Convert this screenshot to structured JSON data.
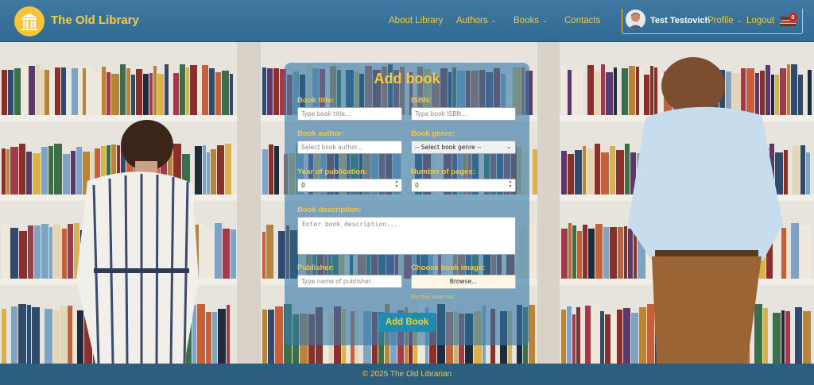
{
  "header": {
    "logo_icon": "library-columns-icon",
    "brand": "The Old Library",
    "nav": {
      "about": "About Library",
      "authors": "Authors",
      "books": "Books",
      "contacts": "Contacts"
    },
    "user": {
      "name": "Test Testovich",
      "profile": "Profile",
      "logout": "Logout",
      "cart_icon": "books-stack-icon",
      "cart_count": "0"
    }
  },
  "form": {
    "title": "Add book",
    "book_title": {
      "label": "Book title:",
      "placeholder": "Type book title..."
    },
    "isbn": {
      "label": "ISBN:",
      "placeholder": "Type book ISBN..."
    },
    "book_author": {
      "label": "Book author:",
      "placeholder": "Select book author..."
    },
    "book_genre": {
      "label": "Book genre:",
      "value": "-- Select book genre --"
    },
    "year": {
      "label": "Year of publication:",
      "value": "0"
    },
    "pages": {
      "label": "Number of pages:",
      "value": "0"
    },
    "description": {
      "label": "Book description:",
      "placeholder": "Enter book description..."
    },
    "publisher": {
      "label": "Publisher:",
      "placeholder": "Type name of publisher."
    },
    "image": {
      "label": "Choose book image:",
      "button": "Browse...",
      "status": "No files selected."
    },
    "submit": "Add Book"
  },
  "footer": {
    "text": "© 2025 The Old Librarian"
  },
  "colors": {
    "accent": "#f7c93d",
    "header_bg": "#3a73a0",
    "panel_bg": "#377aa8",
    "button_bg": "#1b8fb3",
    "footer_bg": "#2c5e80"
  }
}
